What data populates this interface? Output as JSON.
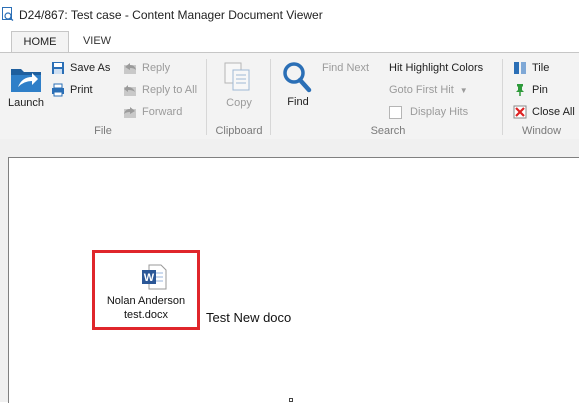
{
  "window": {
    "title": "D24/867: Test case - Content Manager Document Viewer"
  },
  "tabs": [
    {
      "label": "HOME",
      "active": true
    },
    {
      "label": "VIEW",
      "active": false
    }
  ],
  "ribbon": {
    "file": {
      "group_label": "File",
      "launch": "Launch",
      "save_as": "Save As",
      "print": "Print",
      "reply": "Reply",
      "reply_all": "Reply to All",
      "forward": "Forward"
    },
    "clipboard": {
      "group_label": "Clipboard",
      "copy": "Copy"
    },
    "search": {
      "group_label": "Search",
      "find": "Find",
      "find_next": "Find Next",
      "hit_highlight_colors": "Hit Highlight Colors",
      "goto_first_hit": "Goto First Hit",
      "display_hits": "Display Hits"
    },
    "window": {
      "group_label": "Window",
      "tile": "Tile",
      "pin": "Pin",
      "close_all": "Close All"
    }
  },
  "document": {
    "attachment_line1": "Nolan Anderson",
    "attachment_line2": "test.docx",
    "body_text": "Test New doco"
  },
  "colors": {
    "accent": "#2b6fb6",
    "highlight_border": "#e0262b",
    "ribbon_bg": "#f3f3f3"
  }
}
